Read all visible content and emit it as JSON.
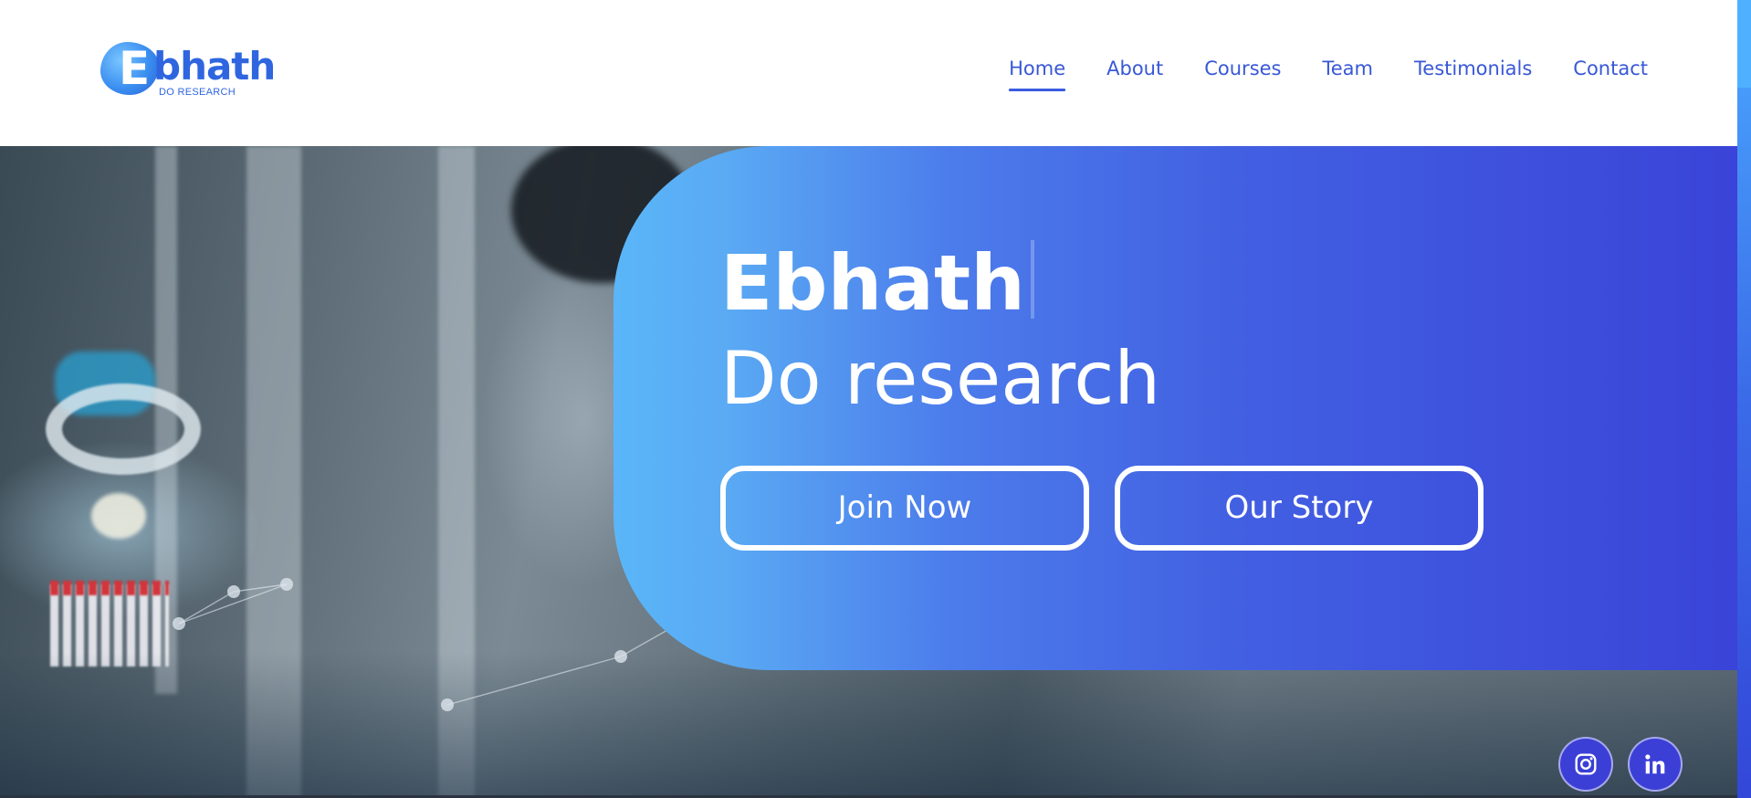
{
  "brand": {
    "logo_letter": "E",
    "logo_word": "bhath",
    "logo_tagline": "DO RESEARCH"
  },
  "nav": {
    "items": [
      {
        "label": "Home",
        "active": true
      },
      {
        "label": "About",
        "active": false
      },
      {
        "label": "Courses",
        "active": false
      },
      {
        "label": "Team",
        "active": false
      },
      {
        "label": "Testimonials",
        "active": false
      },
      {
        "label": "Contact",
        "active": false
      }
    ]
  },
  "hero": {
    "title": "Ebhath",
    "subtitle": "Do research",
    "primary_button": "Join Now",
    "secondary_button": "Our Story"
  },
  "social": [
    {
      "icon": "instagram-icon"
    },
    {
      "icon": "linkedin-icon"
    }
  ],
  "colors": {
    "brand_blue": "#2f66e0",
    "nav_text": "#3858d6",
    "hero_gradient_start": "#5ab6f8",
    "hero_gradient_end": "#3a44d8",
    "social_bg": "#3b3fd6"
  }
}
